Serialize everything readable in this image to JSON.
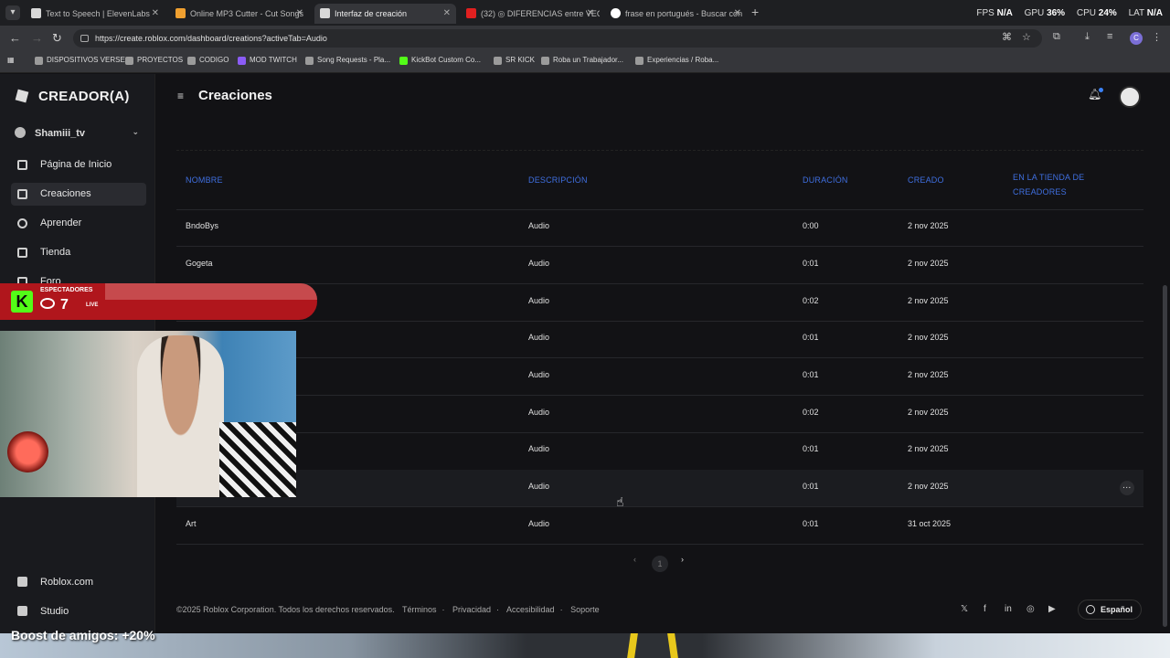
{
  "browser": {
    "tabs": [
      {
        "title": "Text to Speech | ElevenLabs"
      },
      {
        "title": "Online MP3 Cutter - Cut Songs"
      },
      {
        "title": "Interfaz de creación"
      },
      {
        "title": "(32) ◎ DIFERENCIAS entre VEC"
      },
      {
        "title": "frase en portugués - Buscar con"
      }
    ],
    "new_tab": "+",
    "stats": {
      "fps_label": "FPS",
      "fps": "N/A",
      "gpu_label": "GPU",
      "gpu": "36%",
      "cpu_label": "CPU",
      "cpu": "24%",
      "lat_label": "LAT",
      "lat": "N/A"
    },
    "url": "https://create.roblox.com/dashboard/creations?activeTab=Audio",
    "profile_initial": "C",
    "bookmarks": [
      "DISPOSITIVOS VERSE",
      "PROYECTOS",
      "CODIGO",
      "MOD TWITCH",
      "Song Requests - Pla...",
      "KickBot Custom Co...",
      "SR KICK",
      "Roba un Trabajador...",
      "Experiencias / Roba..."
    ]
  },
  "sidebar": {
    "logo": "CREADOR(A)",
    "user": "Shamiii_tv",
    "items": [
      "Página de Inicio",
      "Creaciones",
      "Aprender",
      "Tienda",
      "Foro"
    ],
    "bottom": [
      "Roblox.com",
      "Studio"
    ]
  },
  "header": {
    "title": "Creaciones"
  },
  "table": {
    "columns": [
      "NOMBRE",
      "DESCRIPCIÓN",
      "DURACIÓN",
      "CREADO",
      "EN LA TIENDA DE CREADORES"
    ],
    "rows": [
      {
        "name": "BndoBys",
        "desc": "Audio",
        "dur": "0:00",
        "created": "2 nov 2025"
      },
      {
        "name": "Gogeta",
        "desc": "Audio",
        "dur": "0:01",
        "created": "2 nov 2025"
      },
      {
        "name": "",
        "desc": "Audio",
        "dur": "0:02",
        "created": "2 nov 2025"
      },
      {
        "name": "",
        "desc": "Audio",
        "dur": "0:01",
        "created": "2 nov 2025"
      },
      {
        "name": "",
        "desc": "Audio",
        "dur": "0:01",
        "created": "2 nov 2025"
      },
      {
        "name": "",
        "desc": "Audio",
        "dur": "0:02",
        "created": "2 nov 2025"
      },
      {
        "name": "",
        "desc": "Audio",
        "dur": "0:01",
        "created": "2 nov 2025"
      },
      {
        "name": "",
        "desc": "Audio",
        "dur": "0:01",
        "created": "2 nov 2025"
      },
      {
        "name": "Art",
        "desc": "Audio",
        "dur": "0:01",
        "created": "31 oct 2025"
      }
    ]
  },
  "pagination": {
    "prev": "‹",
    "current": "1",
    "next": "›"
  },
  "footer": {
    "copyright": "©2025 Roblox Corporation. Todos los derechos reservados.",
    "links": [
      "Términos",
      "Privacidad",
      "Accesibilidad",
      "Soporte"
    ],
    "language": "Español"
  },
  "stream_overlay": {
    "viewers_label": "ESPECTADORES",
    "viewers": "7",
    "live_label": "LIVE",
    "boost": "Boost de amigos: +20%"
  },
  "colors": {
    "accent": "#3f6fe0",
    "kick_green": "#53fc18",
    "live_red": "#b0161c"
  }
}
